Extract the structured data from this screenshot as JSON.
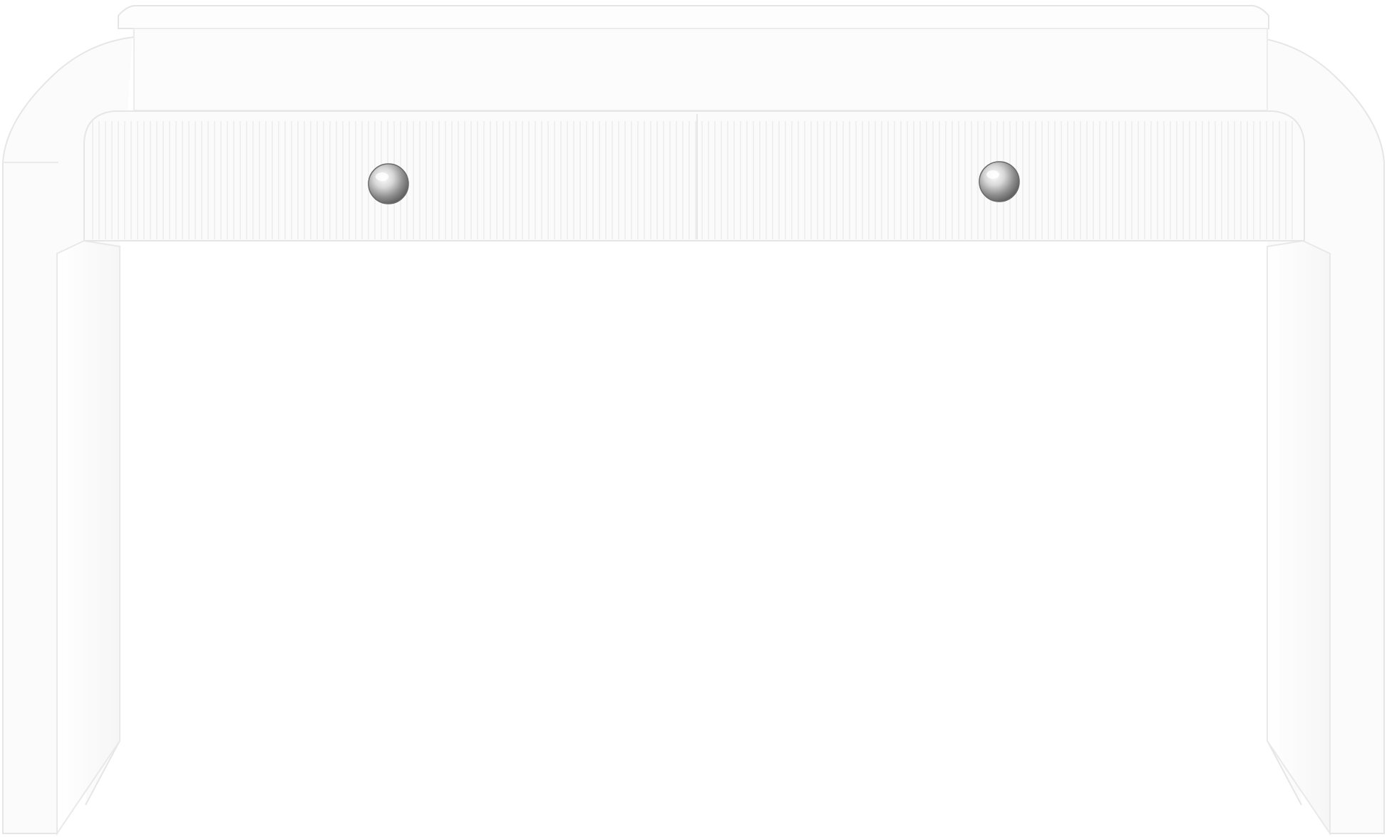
{
  "image": {
    "subject": "white-console-table",
    "background_color": "#ffffff",
    "surface_color": "#fbfbfb",
    "edge_color": "#e9e9e9",
    "shadow_color": "#eeeeee",
    "fluting_color": "#f0f0f0",
    "knob_icons": [
      "chrome-knob-icon",
      "chrome-knob-icon"
    ]
  }
}
